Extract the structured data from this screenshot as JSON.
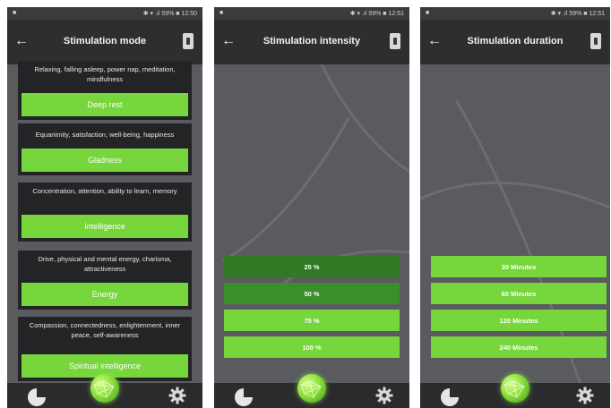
{
  "panels": [
    {
      "status": {
        "left": "■",
        "right": "✱ ▾ .ıl 59% ■ 12:50"
      },
      "title": "Stimulation mode",
      "modes": [
        {
          "description": "Relaxing, falling asleep, power nap, meditation, mindfulness",
          "label": "Deep rest"
        },
        {
          "description": "Equanimity, satisfaction, well-being, happiness",
          "label": "Gladness"
        },
        {
          "description": "Concentration, attention, ability to learn, memory",
          "label": "Intelligence"
        },
        {
          "description": "Drive, physical and mental energy, charisma, attractiveness",
          "label": "Energy"
        },
        {
          "description": "Compassion, connectedness, enlightenment, inner peace, self-awareness",
          "label": "Spiritual intelligence"
        }
      ]
    },
    {
      "status": {
        "left": "■",
        "right": "✱ ▾ .ıl 59% ■ 12:51"
      },
      "title": "Stimulation intensity",
      "options": [
        "25 %",
        "50 %",
        "75 %",
        "100 %"
      ]
    },
    {
      "status": {
        "left": "■",
        "right": "✱ ▾ .ıl 59% ■ 12:51"
      },
      "title": "Stimulation duration",
      "options": [
        "30 Minutes",
        "60 Minutes",
        "120 Minutes",
        "240 Minutes"
      ]
    }
  ],
  "icons": {
    "back": "←",
    "battery": "battery-icon",
    "stats": "pie-chart-icon",
    "home": "globe-icon",
    "settings": "gear-icon"
  },
  "colors": {
    "accent_green": "#76d63b",
    "dim_green": "#2f7a23",
    "mid_green": "#3b8f2a",
    "card_bg": "#232426",
    "appbar_bg": "#2d2e30",
    "screen_bg": "#595b5e"
  }
}
